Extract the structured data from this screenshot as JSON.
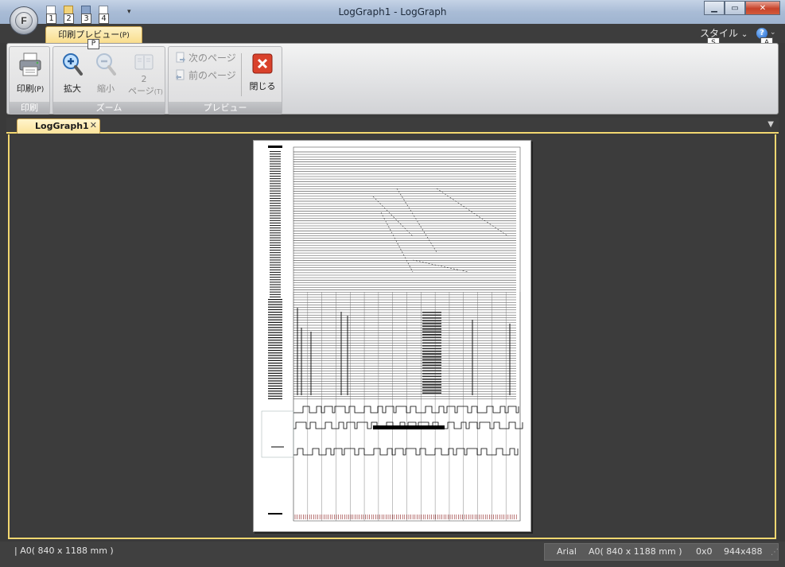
{
  "window": {
    "title": "LogGraph1 - LogGraph",
    "minimize_label": "▁",
    "maximize_label": "▭",
    "close_label": "✕"
  },
  "app_button": {
    "letter": "F",
    "keytip": "F"
  },
  "quick_access": {
    "items": [
      {
        "keytip": "1",
        "icon": "new-document-icon"
      },
      {
        "keytip": "2",
        "icon": "open-folder-icon"
      },
      {
        "keytip": "3",
        "icon": "save-icon"
      },
      {
        "keytip": "4",
        "icon": "check-document-icon"
      }
    ],
    "dropdown": "▾"
  },
  "ribbon_tabs": [
    {
      "label": "印刷プレビュー",
      "accel": "(P)",
      "keytip": "P",
      "active": true
    }
  ],
  "style_menu": {
    "label": "スタイル",
    "chevron": "⌄",
    "keytip": "S"
  },
  "help": {
    "glyph": "?",
    "keytip": "A",
    "chevron": "⌄"
  },
  "ribbon_groups": {
    "print": {
      "caption": "印刷",
      "print_button": {
        "label": "印刷",
        "accel": "(P)",
        "icon": "printer-icon"
      }
    },
    "zoom": {
      "caption": "ズーム",
      "zoom_in": {
        "label": "拡大",
        "icon": "zoom-in-icon"
      },
      "zoom_out": {
        "label": "縮小",
        "icon": "zoom-out-icon"
      },
      "two_page": {
        "label_top": "2",
        "label": "ページ",
        "accel": "(T)",
        "icon": "two-page-icon"
      }
    },
    "preview": {
      "caption": "プレビュー",
      "next_page": {
        "label": "次のページ",
        "icon": "next-page-icon"
      },
      "prev_page": {
        "label": "前のページ",
        "icon": "prev-page-icon"
      },
      "close": {
        "label": "閉じる",
        "icon": "close-preview-icon"
      }
    }
  },
  "document_tab": {
    "label": "LogGraph1",
    "close": "✕"
  },
  "tabbar_dropdown": "▼",
  "status": {
    "left": "|  A0( 840 x 1188 mm )",
    "font": "Arial",
    "paper": "A0( 840 x 1188 mm )",
    "offset": "0x0",
    "size": "944x488"
  },
  "colors": {
    "accent": "#f2d770",
    "close_red": "#c7432b",
    "background": "#3a3a3a"
  }
}
